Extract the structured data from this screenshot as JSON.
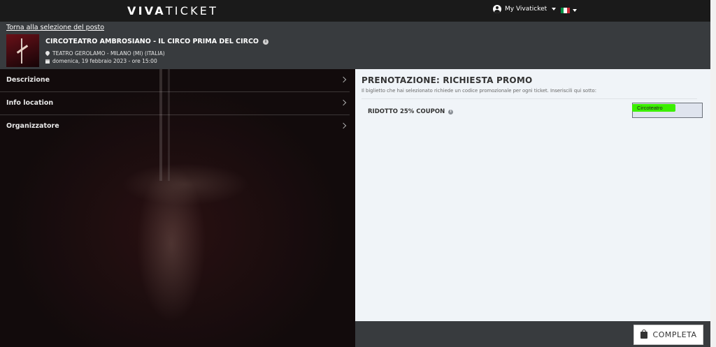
{
  "topbar": {
    "logo_bold": "VIVA",
    "logo_light": "TICKET",
    "account_label": "My Vivaticket",
    "language_icon": "italy-flag-icon"
  },
  "event": {
    "back_link": "Torna alla selezione del posto",
    "title": "CIRCOTEATRO AMBROSIANO - IL CIRCO PRIMA DEL CIRCO",
    "venue": "TEATRO GEROLAMO - MILANO (MI) (ITALIA)",
    "datetime": "domenica, 19 febbraio 2023 - ore 15:00"
  },
  "accordion": {
    "items": [
      {
        "label": "Descrizione"
      },
      {
        "label": "Info location"
      },
      {
        "label": "Organizzatore"
      }
    ]
  },
  "promo": {
    "title": "PRENOTAZIONE: RICHIESTA PROMO",
    "subtitle": "Il biglietto che hai selezionato richiede un codice promozionale per ogni ticket. Inseriscili qui sotto:",
    "ticket_label": "RIDOTTO 25% COUPON",
    "code_value": "Circoteatro"
  },
  "footer": {
    "complete_label": "COMPLETA"
  },
  "colors": {
    "topbar": "#1a1a1a",
    "header": "#383b3e",
    "panel": "#f0f4f8",
    "highlight": "#3bef00"
  }
}
